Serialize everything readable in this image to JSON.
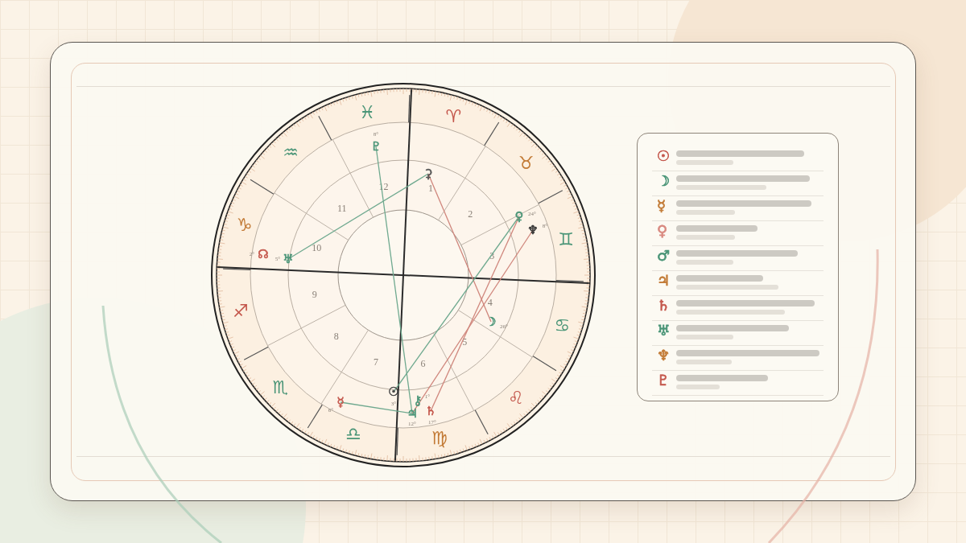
{
  "zodiac": [
    {
      "glyph": "♈",
      "color": "#c4574c"
    },
    {
      "glyph": "♉",
      "color": "#c27a35"
    },
    {
      "glyph": "♊",
      "color": "#4a9577"
    },
    {
      "glyph": "♋",
      "color": "#4a9577"
    },
    {
      "glyph": "♌",
      "color": "#c4574c"
    },
    {
      "glyph": "♍",
      "color": "#c27a35"
    },
    {
      "glyph": "♎",
      "color": "#4a9577"
    },
    {
      "glyph": "♏",
      "color": "#4a9577"
    },
    {
      "glyph": "♐",
      "color": "#c4574c"
    },
    {
      "glyph": "♑",
      "color": "#c27a35"
    },
    {
      "glyph": "♒",
      "color": "#4a9577"
    },
    {
      "glyph": "♓",
      "color": "#4a9577"
    }
  ],
  "houses": [
    "1",
    "2",
    "3",
    "4",
    "5",
    "6",
    "7",
    "8",
    "9",
    "10",
    "11",
    "12"
  ],
  "planets": [
    {
      "glyph": "♇",
      "degree": "8°",
      "color": "#4a9577"
    },
    {
      "glyph": "⚳",
      "color": "#555555"
    },
    {
      "glyph": "♀",
      "degree": "24°",
      "color": "#4a9577"
    },
    {
      "glyph": "♆",
      "degree": "8°",
      "color": "#333333"
    },
    {
      "glyph": "☽",
      "degree": "26°",
      "color": "#4a9577"
    },
    {
      "glyph": "☉",
      "degree": "3°",
      "color": "#444444"
    },
    {
      "glyph": "☿",
      "degree": "6°",
      "color": "#c4574c"
    },
    {
      "glyph": "⚷",
      "degree": "1°",
      "color": "#4a9577"
    },
    {
      "glyph": "♃",
      "degree": "12°",
      "color": "#4a9577"
    },
    {
      "glyph": "♄",
      "degree": "17°",
      "color": "#c4574c"
    },
    {
      "glyph": "♅",
      "degree": "5°",
      "color": "#4a9577"
    },
    {
      "glyph": "☊",
      "degree": "2°",
      "color": "#c4574c"
    }
  ],
  "legend": [
    {
      "glyph": "☉",
      "color": "#c4574c"
    },
    {
      "glyph": "☽",
      "color": "#4a9577"
    },
    {
      "glyph": "☿",
      "color": "#c27a35"
    },
    {
      "glyph": "♀",
      "color": "#d98a80"
    },
    {
      "glyph": "♂",
      "color": "#4a9577"
    },
    {
      "glyph": "♃",
      "color": "#c27a35"
    },
    {
      "glyph": "♄",
      "color": "#c4574c"
    },
    {
      "glyph": "♅",
      "color": "#4a9577"
    },
    {
      "glyph": "♆",
      "color": "#c27a35"
    },
    {
      "glyph": "♇",
      "color": "#c4574c"
    }
  ]
}
